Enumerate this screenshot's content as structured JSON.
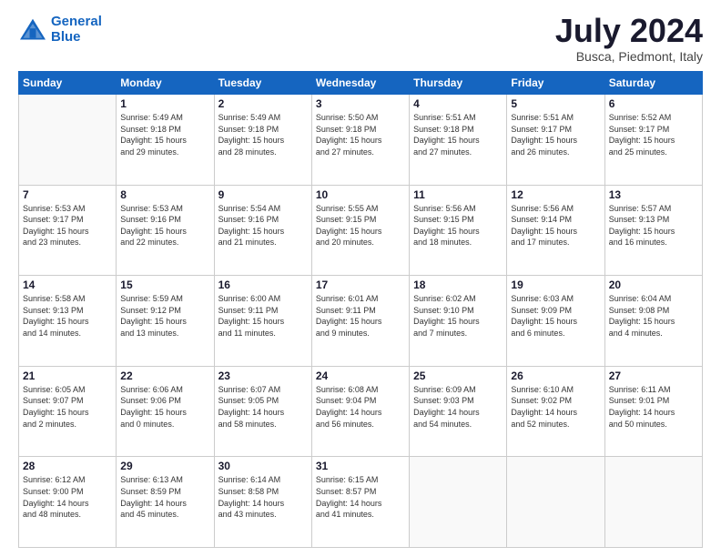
{
  "header": {
    "logo_line1": "General",
    "logo_line2": "Blue",
    "month_year": "July 2024",
    "location": "Busca, Piedmont, Italy"
  },
  "days_of_week": [
    "Sunday",
    "Monday",
    "Tuesday",
    "Wednesday",
    "Thursday",
    "Friday",
    "Saturday"
  ],
  "weeks": [
    [
      {
        "day": "",
        "info": ""
      },
      {
        "day": "1",
        "info": "Sunrise: 5:49 AM\nSunset: 9:18 PM\nDaylight: 15 hours\nand 29 minutes."
      },
      {
        "day": "2",
        "info": "Sunrise: 5:49 AM\nSunset: 9:18 PM\nDaylight: 15 hours\nand 28 minutes."
      },
      {
        "day": "3",
        "info": "Sunrise: 5:50 AM\nSunset: 9:18 PM\nDaylight: 15 hours\nand 27 minutes."
      },
      {
        "day": "4",
        "info": "Sunrise: 5:51 AM\nSunset: 9:18 PM\nDaylight: 15 hours\nand 27 minutes."
      },
      {
        "day": "5",
        "info": "Sunrise: 5:51 AM\nSunset: 9:17 PM\nDaylight: 15 hours\nand 26 minutes."
      },
      {
        "day": "6",
        "info": "Sunrise: 5:52 AM\nSunset: 9:17 PM\nDaylight: 15 hours\nand 25 minutes."
      }
    ],
    [
      {
        "day": "7",
        "info": "Sunrise: 5:53 AM\nSunset: 9:17 PM\nDaylight: 15 hours\nand 23 minutes."
      },
      {
        "day": "8",
        "info": "Sunrise: 5:53 AM\nSunset: 9:16 PM\nDaylight: 15 hours\nand 22 minutes."
      },
      {
        "day": "9",
        "info": "Sunrise: 5:54 AM\nSunset: 9:16 PM\nDaylight: 15 hours\nand 21 minutes."
      },
      {
        "day": "10",
        "info": "Sunrise: 5:55 AM\nSunset: 9:15 PM\nDaylight: 15 hours\nand 20 minutes."
      },
      {
        "day": "11",
        "info": "Sunrise: 5:56 AM\nSunset: 9:15 PM\nDaylight: 15 hours\nand 18 minutes."
      },
      {
        "day": "12",
        "info": "Sunrise: 5:56 AM\nSunset: 9:14 PM\nDaylight: 15 hours\nand 17 minutes."
      },
      {
        "day": "13",
        "info": "Sunrise: 5:57 AM\nSunset: 9:13 PM\nDaylight: 15 hours\nand 16 minutes."
      }
    ],
    [
      {
        "day": "14",
        "info": "Sunrise: 5:58 AM\nSunset: 9:13 PM\nDaylight: 15 hours\nand 14 minutes."
      },
      {
        "day": "15",
        "info": "Sunrise: 5:59 AM\nSunset: 9:12 PM\nDaylight: 15 hours\nand 13 minutes."
      },
      {
        "day": "16",
        "info": "Sunrise: 6:00 AM\nSunset: 9:11 PM\nDaylight: 15 hours\nand 11 minutes."
      },
      {
        "day": "17",
        "info": "Sunrise: 6:01 AM\nSunset: 9:11 PM\nDaylight: 15 hours\nand 9 minutes."
      },
      {
        "day": "18",
        "info": "Sunrise: 6:02 AM\nSunset: 9:10 PM\nDaylight: 15 hours\nand 7 minutes."
      },
      {
        "day": "19",
        "info": "Sunrise: 6:03 AM\nSunset: 9:09 PM\nDaylight: 15 hours\nand 6 minutes."
      },
      {
        "day": "20",
        "info": "Sunrise: 6:04 AM\nSunset: 9:08 PM\nDaylight: 15 hours\nand 4 minutes."
      }
    ],
    [
      {
        "day": "21",
        "info": "Sunrise: 6:05 AM\nSunset: 9:07 PM\nDaylight: 15 hours\nand 2 minutes."
      },
      {
        "day": "22",
        "info": "Sunrise: 6:06 AM\nSunset: 9:06 PM\nDaylight: 15 hours\nand 0 minutes."
      },
      {
        "day": "23",
        "info": "Sunrise: 6:07 AM\nSunset: 9:05 PM\nDaylight: 14 hours\nand 58 minutes."
      },
      {
        "day": "24",
        "info": "Sunrise: 6:08 AM\nSunset: 9:04 PM\nDaylight: 14 hours\nand 56 minutes."
      },
      {
        "day": "25",
        "info": "Sunrise: 6:09 AM\nSunset: 9:03 PM\nDaylight: 14 hours\nand 54 minutes."
      },
      {
        "day": "26",
        "info": "Sunrise: 6:10 AM\nSunset: 9:02 PM\nDaylight: 14 hours\nand 52 minutes."
      },
      {
        "day": "27",
        "info": "Sunrise: 6:11 AM\nSunset: 9:01 PM\nDaylight: 14 hours\nand 50 minutes."
      }
    ],
    [
      {
        "day": "28",
        "info": "Sunrise: 6:12 AM\nSunset: 9:00 PM\nDaylight: 14 hours\nand 48 minutes."
      },
      {
        "day": "29",
        "info": "Sunrise: 6:13 AM\nSunset: 8:59 PM\nDaylight: 14 hours\nand 45 minutes."
      },
      {
        "day": "30",
        "info": "Sunrise: 6:14 AM\nSunset: 8:58 PM\nDaylight: 14 hours\nand 43 minutes."
      },
      {
        "day": "31",
        "info": "Sunrise: 6:15 AM\nSunset: 8:57 PM\nDaylight: 14 hours\nand 41 minutes."
      },
      {
        "day": "",
        "info": ""
      },
      {
        "day": "",
        "info": ""
      },
      {
        "day": "",
        "info": ""
      }
    ]
  ]
}
